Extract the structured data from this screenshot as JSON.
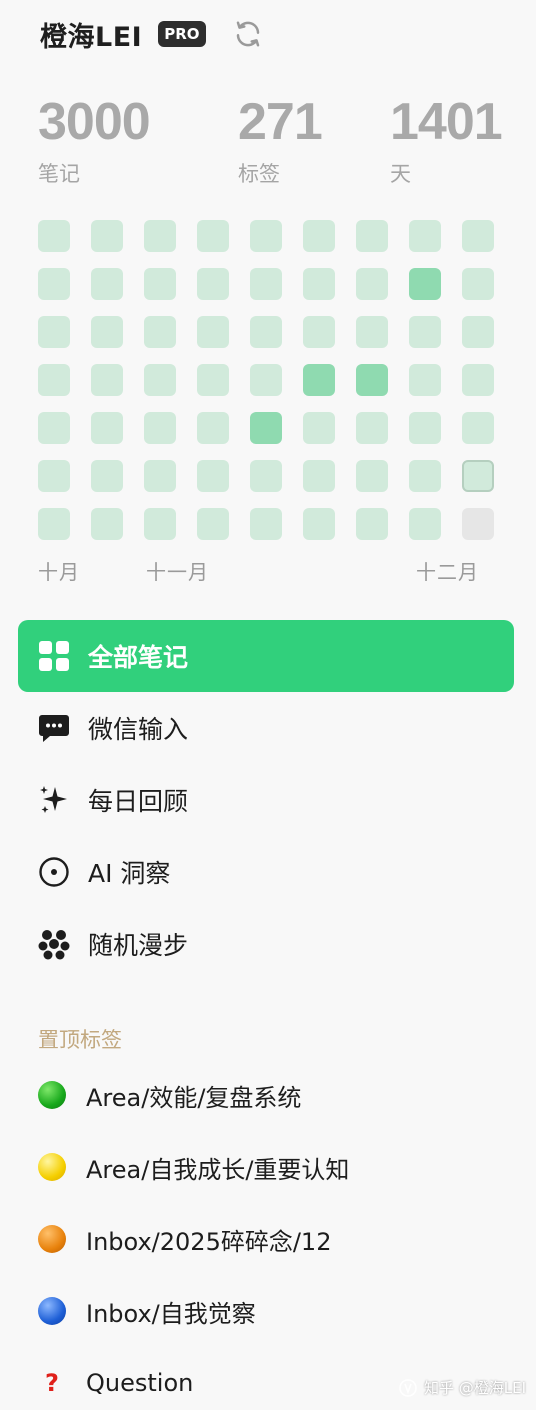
{
  "header": {
    "username": "橙海LEI",
    "badge": "PRO",
    "sync_icon": "sync-icon"
  },
  "stats": [
    {
      "value": "3000",
      "label": "笔记"
    },
    {
      "value": "271",
      "label": "标签"
    },
    {
      "value": "1401",
      "label": "天"
    }
  ],
  "heatmap": {
    "colors": {
      "empty": "#d1eadb",
      "active": "#8fdab0",
      "future": "#e6e6e6",
      "today_border": "#b5cfbf"
    },
    "columns": [
      [
        "empty",
        "empty",
        "empty",
        "empty",
        "empty",
        "empty",
        "empty"
      ],
      [
        "empty",
        "empty",
        "empty",
        "empty",
        "empty",
        "empty",
        "empty"
      ],
      [
        "empty",
        "empty",
        "empty",
        "empty",
        "empty",
        "empty",
        "empty"
      ],
      [
        "empty",
        "empty",
        "empty",
        "empty",
        "empty",
        "empty",
        "empty"
      ],
      [
        "empty",
        "empty",
        "empty",
        "empty",
        "active",
        "empty",
        "empty"
      ],
      [
        "empty",
        "empty",
        "empty",
        "active",
        "empty",
        "empty",
        "empty"
      ],
      [
        "empty",
        "empty",
        "empty",
        "active",
        "empty",
        "empty",
        "empty"
      ],
      [
        "empty",
        "active",
        "empty",
        "empty",
        "empty",
        "empty",
        "empty"
      ],
      [
        "empty",
        "empty",
        "empty",
        "empty",
        "empty",
        "today",
        "future"
      ]
    ],
    "months": [
      "十月",
      "十一月",
      "十二月"
    ]
  },
  "nav": [
    {
      "label": "全部笔记",
      "icon": "grid-icon",
      "active": true
    },
    {
      "label": "微信输入",
      "icon": "chat-bubble-icon",
      "active": false
    },
    {
      "label": "每日回顾",
      "icon": "sparkle-icon",
      "active": false
    },
    {
      "label": "AI 洞察",
      "icon": "target-icon",
      "active": false
    },
    {
      "label": "随机漫步",
      "icon": "dots-cluster-icon",
      "active": false
    }
  ],
  "pinned": {
    "title": "置顶标签",
    "tags": [
      {
        "label": "Area/效能/复盘系统",
        "icon": "green-circle-icon",
        "color": "#17a81b"
      },
      {
        "label": "Area/自我成长/重要认知",
        "icon": "yellow-circle-icon",
        "color": "#f5cf00"
      },
      {
        "label": "Inbox/2025碎碎念/12",
        "icon": "orange-circle-icon",
        "color": "#e8820c"
      },
      {
        "label": "Inbox/自我觉察",
        "icon": "blue-circle-icon",
        "color": "#1e5fd6"
      },
      {
        "label": "Question",
        "icon": "red-question-icon",
        "color": "#e0201a"
      }
    ]
  },
  "watermark": "知乎 @橙海LEI"
}
